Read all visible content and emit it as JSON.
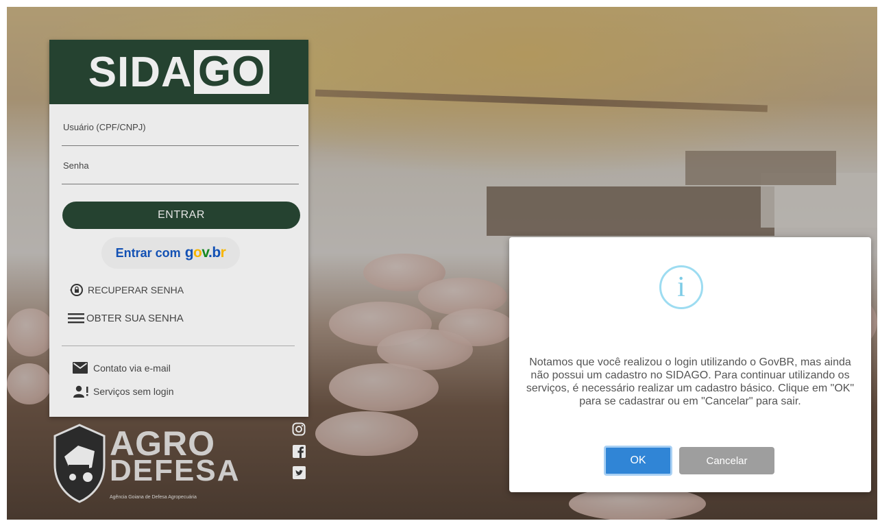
{
  "brand": {
    "logo_prefix": "SIDA",
    "logo_boxed": "GO",
    "colors": {
      "primary": "#254230",
      "panel": "#ebebeb",
      "ok": "#3085d6",
      "cancel": "#9e9e9e",
      "info": "#9ddcf1"
    }
  },
  "login": {
    "user_label": "Usuário (CPF/CNPJ)",
    "password_label": "Senha",
    "submit_label": "ENTRAR",
    "govbr_prefix": "Entrar com",
    "govbr_logo_text": "gov.br",
    "recover_label": "RECUPERAR SENHA",
    "obtain_label": "OBTER SUA SENHA",
    "contact_label": "Contato via e-mail",
    "services_label": "Serviços sem login"
  },
  "footer": {
    "agro_line1": "AGRO",
    "agro_line2": "DEFESA",
    "agro_small": "Agência Goiana de Defesa Agropecuária",
    "social_icons": [
      "instagram-icon",
      "facebook-icon",
      "twitter-icon"
    ]
  },
  "modal": {
    "icon": "info-icon",
    "icon_glyph": "i",
    "message": "Notamos que você realizou o login utilizando o GovBR, mas ainda não possui um cadastro no SIDAGO. Para continuar utilizando os serviços, é necessário realizar um cadastro básico. Clique em \"OK\" para se cadastrar ou em \"Cancelar\" para sair.",
    "ok_label": "OK",
    "cancel_label": "Cancelar"
  }
}
